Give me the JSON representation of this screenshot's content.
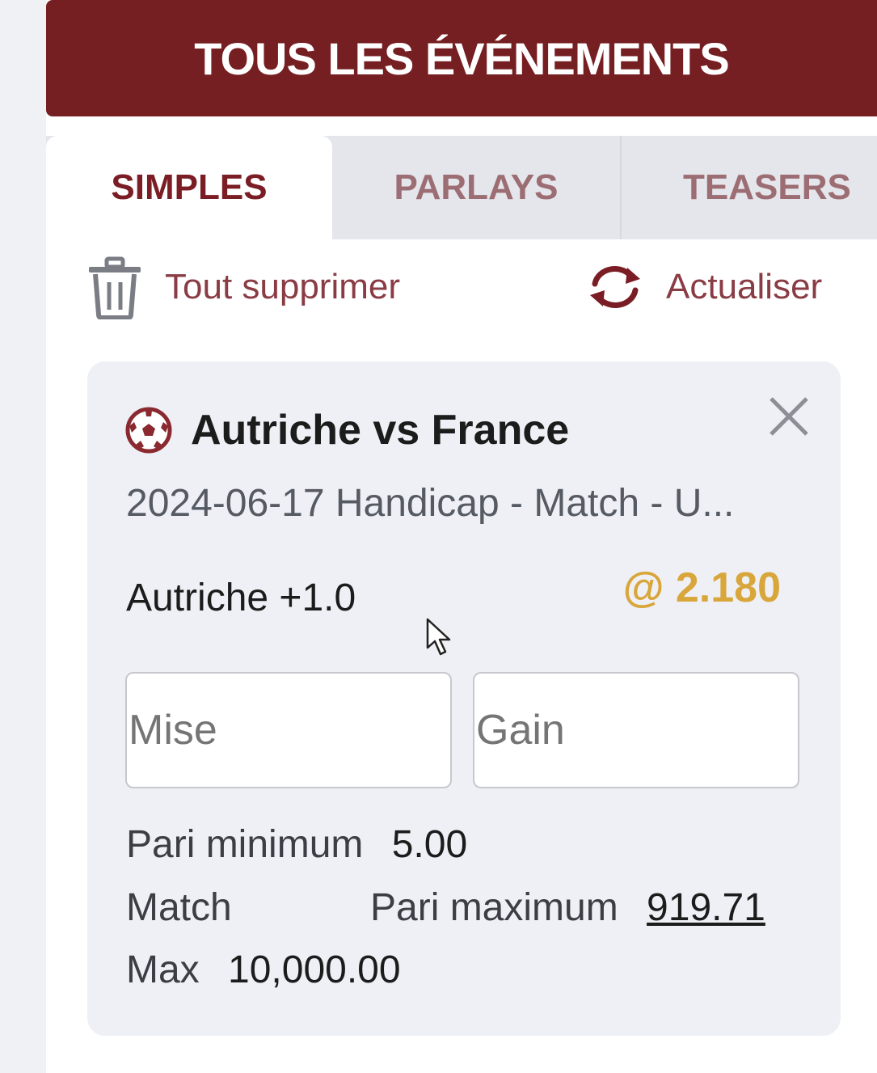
{
  "header": {
    "title": "TOUS LES ÉVÉNEMENTS"
  },
  "tabs": [
    {
      "label": "SIMPLES",
      "active": true
    },
    {
      "label": "PARLAYS",
      "active": false
    },
    {
      "label": "TEASERS",
      "active": false
    }
  ],
  "actions": {
    "delete_all": {
      "label": "Tout supprimer",
      "icon": "trash-icon"
    },
    "refresh": {
      "label": "Actualiser",
      "icon": "refresh-icon"
    }
  },
  "bet": {
    "sport_icon": "soccer-ball-icon",
    "match": "Autriche vs France",
    "description": "2024-06-17 Handicap - Match - U...",
    "selection": "Autriche +1.0",
    "odds": "@ 2.180",
    "stake_placeholder": "Mise",
    "win_placeholder": "Gain",
    "min_label": "Pari minimum",
    "min_value": "5.00",
    "match_label": "Match",
    "max_label": "Pari maximum",
    "max_value": "919.71",
    "cap_label": "Max",
    "cap_value": "10,000.00"
  },
  "colors": {
    "header_bg": "#761f22",
    "accent": "#7a1d25",
    "odds": "#d8a63a",
    "card_bg": "#eff0f5"
  }
}
